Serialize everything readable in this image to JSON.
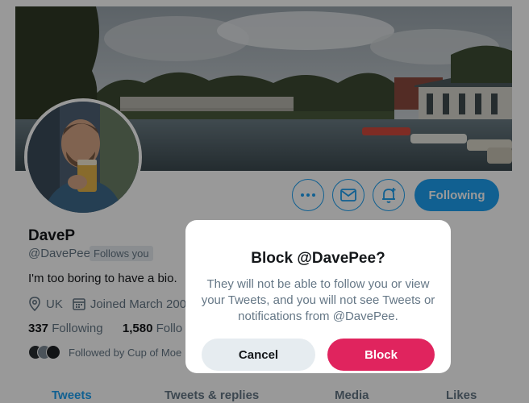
{
  "profile": {
    "display_name": "DaveP",
    "handle": "@DavePee",
    "follows_badge": "Follows you",
    "bio": "I'm too boring to have a bio.",
    "location": "UK",
    "joined": "Joined March 200",
    "following_count": "337",
    "following_label": "Following",
    "followers_count": "1,580",
    "followers_label": "Follo",
    "followed_by": "Followed by Cup of Moe"
  },
  "actions": {
    "more_icon": "more-icon",
    "message_icon": "envelope-icon",
    "notify_icon": "bell-plus-icon",
    "following_label": "Following"
  },
  "tabs": [
    {
      "label": "Tweets"
    },
    {
      "label": "Tweets & replies"
    },
    {
      "label": "Media"
    },
    {
      "label": "Likes"
    }
  ],
  "modal": {
    "title": "Block @DavePee?",
    "body": "They will not be able to follow you or view your Tweets, and you will not see Tweets or notifications from @DavePee.",
    "cancel_label": "Cancel",
    "block_label": "Block"
  },
  "colors": {
    "accent": "#1da1f2",
    "danger": "#e0245e",
    "muted": "#657786",
    "overlay": "rgba(0,0,0,0.4)"
  }
}
